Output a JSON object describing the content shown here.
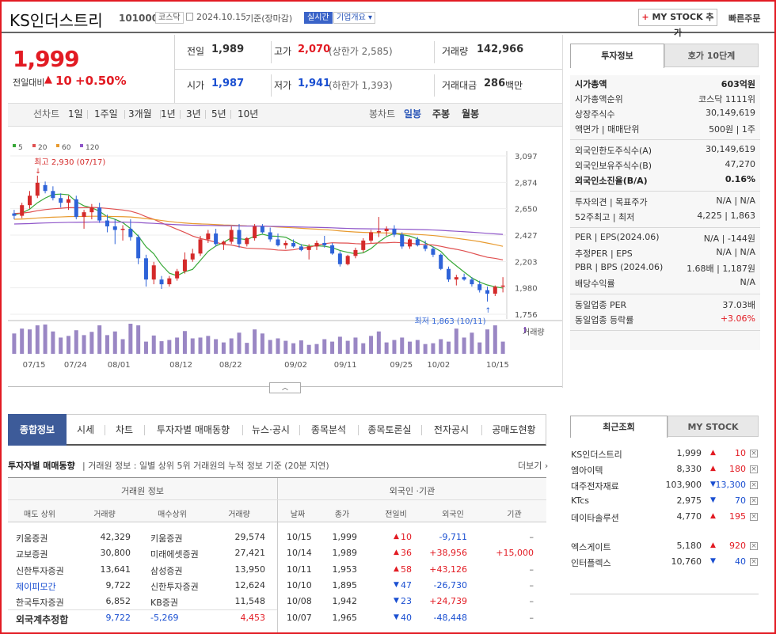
{
  "header": {
    "title": "KS인더스트리",
    "code": "101000",
    "market": "코스닥",
    "date": "2024.10.15",
    "date_basis": "기준(장마감)",
    "realtime": "실시간",
    "company_info": "기업개요",
    "mystock_btn": "MY STOCK 추가",
    "quick_order": "빠른주문"
  },
  "price": {
    "current": "1,999",
    "change_label": "전일대비",
    "change_arrow": "▲",
    "change": "10",
    "change_pct": "+0.50%"
  },
  "summary": {
    "prev_label": "전일",
    "prev": "1,989",
    "high_label": "고가",
    "high": "2,070",
    "high_limit": "(상한가 2,585)",
    "volume_label": "거래량",
    "volume": "142,966",
    "open_label": "시가",
    "open": "1,987",
    "low_label": "저가",
    "low": "1,941",
    "low_limit": "(하한가 1,393)",
    "amount_label": "거래대금",
    "amount": "286",
    "amount_unit": "백만"
  },
  "period_tabs": {
    "label": "선차트",
    "items": [
      "1일",
      "1주일",
      "3개월",
      "1년",
      "3년",
      "5년",
      "10년"
    ],
    "candle_label": "봉차트",
    "candle_items": [
      "일봉",
      "주봉",
      "월봉"
    ]
  },
  "chart_data": {
    "type": "candlestick",
    "legend": [
      "5",
      "20",
      "60",
      "120"
    ],
    "legend_colors": [
      "#37a837",
      "#e05050",
      "#e89a2e",
      "#8f56c9"
    ],
    "y_ticks": [
      "3,097",
      "2,874",
      "2,650",
      "2,427",
      "2,203",
      "1,980",
      "1,756"
    ],
    "ylim": [
      1756,
      3097
    ],
    "x_ticks": [
      "07/15",
      "07/24",
      "08/01",
      "08/12",
      "08/22",
      "09/02",
      "09/11",
      "09/25",
      "10/02",
      "10/15"
    ],
    "high_note": "최고 2,930 (07/17)",
    "low_note": "최저 1,863 (10/11)",
    "volume_label": "거래량",
    "candles": [
      [
        2610,
        2640,
        2560,
        2590
      ],
      [
        2590,
        2700,
        2570,
        2680
      ],
      [
        2680,
        2800,
        2650,
        2760
      ],
      [
        2760,
        2930,
        2740,
        2870
      ],
      [
        2850,
        2880,
        2780,
        2800
      ],
      [
        2800,
        2840,
        2720,
        2740
      ],
      [
        2740,
        2780,
        2660,
        2700
      ],
      [
        2700,
        2760,
        2640,
        2730
      ],
      [
        2730,
        2760,
        2560,
        2580
      ],
      [
        2580,
        2640,
        2480,
        2620
      ],
      [
        2620,
        2690,
        2560,
        2660
      ],
      [
        2660,
        2700,
        2530,
        2550
      ],
      [
        2550,
        2600,
        2450,
        2500
      ],
      [
        2500,
        2560,
        2350,
        2470
      ],
      [
        2470,
        2510,
        2380,
        2480
      ],
      [
        2480,
        2560,
        2380,
        2410
      ],
      [
        2410,
        2430,
        2180,
        2230
      ],
      [
        2230,
        2260,
        1990,
        2050
      ],
      [
        2050,
        2200,
        2010,
        2170
      ],
      [
        2050,
        2080,
        1970,
        2010
      ],
      [
        2010,
        2080,
        1990,
        2060
      ],
      [
        2060,
        2140,
        2040,
        2120
      ],
      [
        2120,
        2280,
        2100,
        2220
      ],
      [
        2220,
        2310,
        2200,
        2270
      ],
      [
        2270,
        2420,
        2250,
        2390
      ],
      [
        2390,
        2470,
        2360,
        2440
      ],
      [
        2440,
        2480,
        2330,
        2350
      ],
      [
        2350,
        2380,
        2300,
        2370
      ],
      [
        2370,
        2500,
        2350,
        2470
      ],
      [
        2470,
        2520,
        2320,
        2350
      ],
      [
        2350,
        2410,
        2330,
        2400
      ],
      [
        2400,
        2520,
        2380,
        2500
      ],
      [
        2500,
        2520,
        2440,
        2450
      ],
      [
        2450,
        2490,
        2370,
        2390
      ],
      [
        2390,
        2440,
        2330,
        2340
      ],
      [
        2340,
        2380,
        2310,
        2360
      ],
      [
        2360,
        2390,
        2320,
        2330
      ],
      [
        2330,
        2350,
        2290,
        2300
      ],
      [
        2300,
        2350,
        2220,
        2330
      ],
      [
        2330,
        2380,
        2300,
        2360
      ],
      [
        2360,
        2420,
        2320,
        2340
      ],
      [
        2340,
        2360,
        2260,
        2270
      ],
      [
        2270,
        2290,
        2160,
        2180
      ],
      [
        2180,
        2260,
        2170,
        2250
      ],
      [
        2250,
        2320,
        2230,
        2300
      ],
      [
        2300,
        2400,
        2280,
        2380
      ],
      [
        2380,
        2470,
        2360,
        2450
      ],
      [
        2450,
        2580,
        2410,
        2460
      ],
      [
        2460,
        2500,
        2420,
        2480
      ],
      [
        2480,
        2510,
        2410,
        2430
      ],
      [
        2430,
        2450,
        2310,
        2330
      ],
      [
        2330,
        2400,
        2310,
        2390
      ],
      [
        2390,
        2410,
        2330,
        2340
      ],
      [
        2340,
        2380,
        2290,
        2310
      ],
      [
        2310,
        2330,
        2240,
        2260
      ],
      [
        2260,
        2270,
        2130,
        2140
      ],
      [
        2140,
        2160,
        2030,
        2050
      ],
      [
        2050,
        2090,
        2000,
        2070
      ],
      [
        2070,
        2100,
        2040,
        2050
      ],
      [
        2050,
        2070,
        1990,
        2010
      ],
      [
        2010,
        2040,
        1940,
        1960
      ],
      [
        1960,
        1990,
        1863,
        1930
      ],
      [
        1930,
        2000,
        1910,
        1990
      ],
      [
        1989,
        2070,
        1941,
        1999
      ]
    ],
    "volumes": [
      50,
      62,
      60,
      70,
      72,
      55,
      40,
      44,
      58,
      46,
      54,
      70,
      46,
      55,
      36,
      74,
      70,
      30,
      45,
      31,
      34,
      40,
      56,
      38,
      40,
      44,
      36,
      28,
      38,
      52,
      27,
      60,
      50,
      34,
      38,
      32,
      26,
      33,
      22,
      24,
      36,
      30,
      42,
      32,
      40,
      26,
      44,
      55,
      28,
      34,
      40,
      30,
      34,
      24,
      26,
      36,
      30,
      62,
      40,
      52,
      28,
      60,
      70,
      30
    ]
  },
  "invest_tabs": [
    "투자정보",
    "호가 10단계"
  ],
  "invest": {
    "g1": [
      {
        "label": "시가총액",
        "value": "603억원",
        "bold": true
      },
      {
        "label": "시가총액순위",
        "value": "코스닥 1111위"
      },
      {
        "label": "상장주식수",
        "value": "30,149,619"
      },
      {
        "label": "액면가 | 매매단위",
        "value": "500원 | 1주"
      }
    ],
    "g2": [
      {
        "label": "외국인한도주식수(A)",
        "value": "30,149,619"
      },
      {
        "label": "외국인보유주식수(B)",
        "value": "47,270"
      },
      {
        "label": "외국인소진율(B/A)",
        "value": "0.16%",
        "bold": true
      }
    ],
    "g3": [
      {
        "label": "투자의견 | 목표주가",
        "value": "N/A | N/A"
      },
      {
        "label": "52주최고 | 최저",
        "value": "4,225 | 1,863"
      }
    ],
    "g4": [
      {
        "label": "PER | EPS(2024.06)",
        "value": "N/A | -144원"
      },
      {
        "label": "추정PER | EPS",
        "value": "N/A | N/A"
      },
      {
        "label": "PBR | BPS (2024.06)",
        "value": "1.68배 | 1,187원"
      },
      {
        "label": "배당수익률",
        "value": "N/A"
      }
    ],
    "g5": [
      {
        "label": "동일업종 PER",
        "value": "37.03배"
      },
      {
        "label": "동일업종 등락률",
        "value": "+3.06%"
      }
    ]
  },
  "bottom_tabs": [
    "종합정보",
    "시세",
    "차트",
    "투자자별 매매동향",
    "뉴스·공시",
    "종목분석",
    "종목토론실",
    "전자공시",
    "공매도현황"
  ],
  "trader": {
    "title": "투자자별 매매동향",
    "desc": "거래원 정보 : 일별 상위 5위 거래원의 누적 정보 기준 (20분 지연)",
    "more": "더보기",
    "group1": "거래원 정보",
    "group2": "외국인 ·기관",
    "headers": [
      "매도 상위",
      "거래량",
      "매수상위",
      "거래량",
      "날짜",
      "종가",
      "전일비",
      "외국인",
      "기관"
    ],
    "rows": [
      {
        "sell": "키움증권",
        "sv": "42,329",
        "buy": "키움증권",
        "bv": "29,574",
        "date": "10/15",
        "close": "1,999",
        "arrow": "▲",
        "chg": "10",
        "foreign": "-9,711",
        "inst": "–"
      },
      {
        "sell": "교보증권",
        "sv": "30,800",
        "buy": "미래에셋증권",
        "bv": "27,421",
        "date": "10/14",
        "close": "1,989",
        "arrow": "▲",
        "chg": "36",
        "foreign": "+38,956",
        "inst": "+15,000"
      },
      {
        "sell": "신한투자증권",
        "sv": "13,641",
        "buy": "삼성증권",
        "bv": "13,950",
        "date": "10/11",
        "close": "1,953",
        "arrow": "▲",
        "chg": "58",
        "foreign": "+43,126",
        "inst": "–"
      },
      {
        "sell": "제이피모간",
        "sv": "9,722",
        "buy": "신한투자증권",
        "bv": "12,624",
        "date": "10/10",
        "close": "1,895",
        "arrow": "▼",
        "chg": "47",
        "foreign": "-26,730",
        "inst": "–"
      },
      {
        "sell": "한국투자증권",
        "sv": "6,852",
        "buy": "KB증권",
        "bv": "11,548",
        "date": "10/08",
        "close": "1,942",
        "arrow": "▼",
        "chg": "23",
        "foreign": "+24,739",
        "inst": "–"
      }
    ],
    "foreign_est": {
      "label": "외국계추정합",
      "sell": "9,722",
      "net": "-5,269",
      "buy": "4,453",
      "date": "10/07",
      "close": "1,965",
      "arrow": "▼",
      "chg": "40",
      "foreign": "-48,448",
      "inst": "–"
    }
  },
  "recent_tabs": [
    "최근조회",
    "MY STOCK"
  ],
  "recent": [
    {
      "name": "KS인더스트리",
      "price": "1,999",
      "arrow": "▲",
      "chg": "10"
    },
    {
      "name": "엠아이텍",
      "price": "8,330",
      "arrow": "▲",
      "chg": "180"
    },
    {
      "name": "대주전자재료",
      "price": "103,900",
      "arrow": "▼",
      "chg": "13,300"
    },
    {
      "name": "KTcs",
      "price": "2,975",
      "arrow": "▼",
      "chg": "70"
    },
    {
      "name": "데이타솔루션",
      "price": "4,770",
      "arrow": "▲",
      "chg": "195"
    },
    {
      "name": "엑스게이트",
      "price": "5,180",
      "arrow": "▲",
      "chg": "920"
    },
    {
      "name": "인터플렉스",
      "price": "10,760",
      "arrow": "▼",
      "chg": "40"
    }
  ]
}
